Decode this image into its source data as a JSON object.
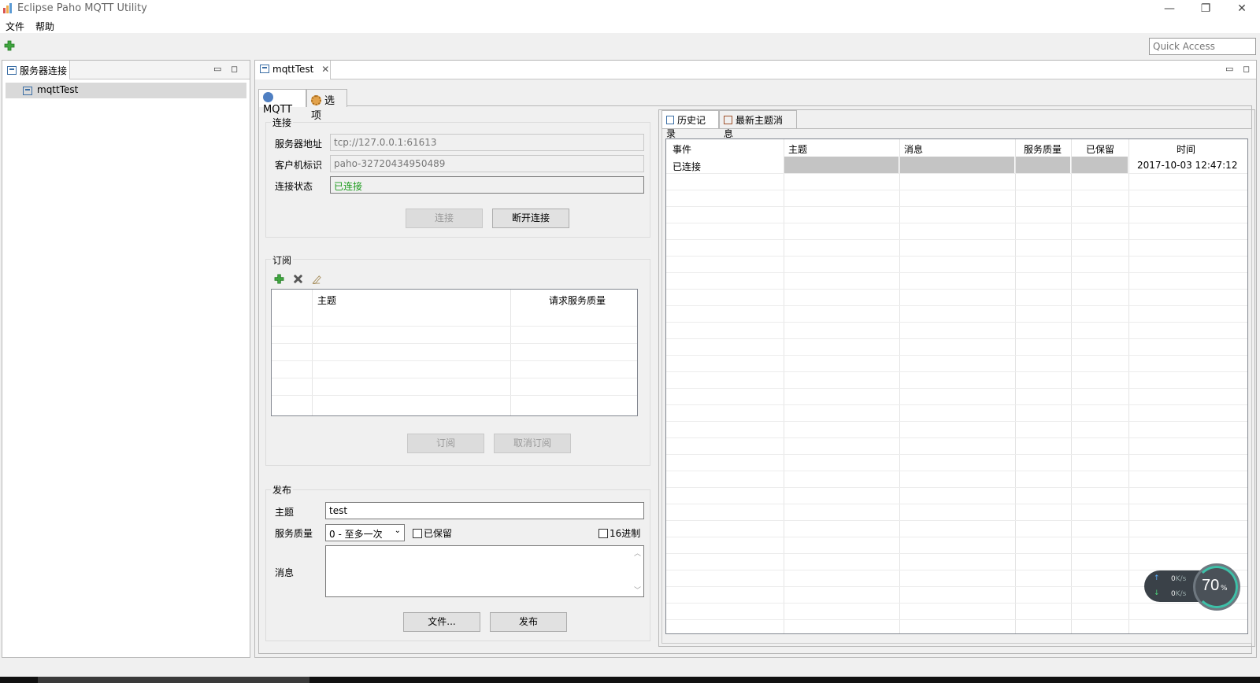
{
  "window": {
    "title": "Eclipse Paho MQTT Utility",
    "minimize": "—",
    "restore": "❐",
    "close": "✕"
  },
  "menu": [
    "文件",
    "帮助"
  ],
  "toolbar": {
    "quick_access_placeholder": "Quick Access"
  },
  "left_view": {
    "tab_label": "服务器连接",
    "tree_items": [
      "mqttTest"
    ]
  },
  "editor": {
    "tab_label": "mqttTest",
    "inner_tabs": [
      "MQTT",
      "选项"
    ]
  },
  "connection": {
    "group_title": "连接",
    "server_label": "服务器地址",
    "server_value": "tcp://127.0.0.1:61613",
    "client_label": "客户机标识",
    "client_value": "paho-32720434950489",
    "status_label": "连接状态",
    "status_value": "已连接",
    "connect_button": "连接",
    "disconnect_button": "断开连接"
  },
  "subscribe": {
    "group_title": "订阅",
    "columns": [
      "主题",
      "请求服务质量"
    ],
    "subscribe_button": "订阅",
    "unsubscribe_button": "取消订阅"
  },
  "publish": {
    "group_title": "发布",
    "topic_label": "主题",
    "topic_value": "test",
    "qos_label": "服务质量",
    "qos_value": "0 - 至多一次",
    "retained_label": "已保留",
    "hex_label": "16进制",
    "message_label": "消息",
    "file_button": "文件...",
    "publish_button": "发布"
  },
  "history": {
    "tabs": [
      "历史记录",
      "最新主题消息"
    ],
    "columns": [
      "事件",
      "主题",
      "消息",
      "服务质量",
      "已保留",
      "时间"
    ],
    "rows": [
      {
        "event": "已连接",
        "time": "2017-10-03 12:47:12"
      }
    ]
  },
  "network_widget": {
    "upload": "0",
    "download": "0",
    "unit": "K/s",
    "percent": "70",
    "percent_sign": "%"
  },
  "colors": {
    "connected_green": "#1a9a1a",
    "selection_grey": "#d9d9d9",
    "accent_blue": "#3b6ea5"
  }
}
